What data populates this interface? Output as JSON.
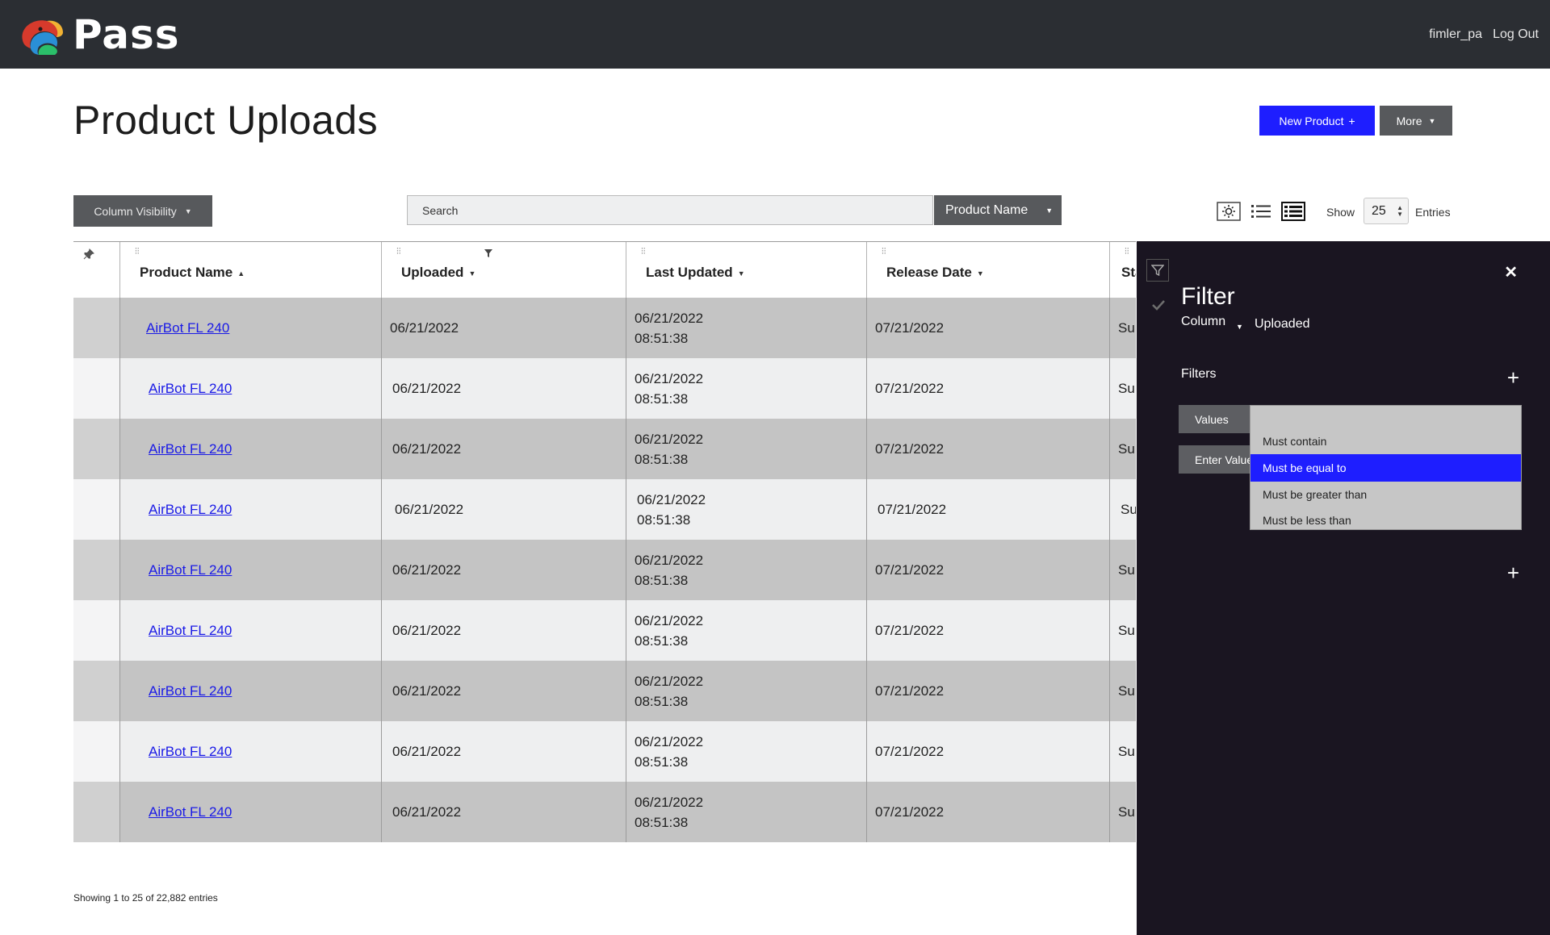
{
  "app": {
    "brand": "Pass",
    "username": "fimler_pa",
    "logout_label": "Log Out"
  },
  "header": {
    "title": "Product Uploads",
    "new_product_label": "New Product",
    "more_label": "More"
  },
  "toolbar": {
    "column_visibility_label": "Column Visibility",
    "search_value": "Search",
    "search_field_label": "Product Name",
    "show_label": "Show",
    "page_size": "25",
    "entries_label": "Entries"
  },
  "table": {
    "columns": [
      "Product Name",
      "Uploaded",
      "Last Updated",
      "Release Date",
      "Sta"
    ],
    "rows": [
      {
        "name": "AirBot FL 240",
        "uploaded": "06/21/2022",
        "updated_date": "06/21/2022",
        "updated_time": "08:51:38",
        "release": "07/21/2022",
        "status": "Su"
      },
      {
        "name": "AirBot FL 240",
        "uploaded": "06/21/2022",
        "updated_date": "06/21/2022",
        "updated_time": "08:51:38",
        "release": "07/21/2022",
        "status": "Su"
      },
      {
        "name": "AirBot FL 240",
        "uploaded": "06/21/2022",
        "updated_date": "06/21/2022",
        "updated_time": "08:51:38",
        "release": "07/21/2022",
        "status": "Su"
      },
      {
        "name": "AirBot FL 240",
        "uploaded": "06/21/2022",
        "updated_date": "06/21/2022",
        "updated_time": "08:51:38",
        "release": "07/21/2022",
        "status": "Su"
      },
      {
        "name": "AirBot FL 240",
        "uploaded": "06/21/2022",
        "updated_date": "06/21/2022",
        "updated_time": "08:51:38",
        "release": "07/21/2022",
        "status": "Su"
      },
      {
        "name": "AirBot FL 240",
        "uploaded": "06/21/2022",
        "updated_date": "06/21/2022",
        "updated_time": "08:51:38",
        "release": "07/21/2022",
        "status": "Su"
      },
      {
        "name": "AirBot FL 240",
        "uploaded": "06/21/2022",
        "updated_date": "06/21/2022",
        "updated_time": "08:51:38",
        "release": "07/21/2022",
        "status": "Su"
      },
      {
        "name": "AirBot FL 240",
        "uploaded": "06/21/2022",
        "updated_date": "06/21/2022",
        "updated_time": "08:51:38",
        "release": "07/21/2022",
        "status": "Su"
      },
      {
        "name": "AirBot FL 240",
        "uploaded": "06/21/2022",
        "updated_date": "06/21/2022",
        "updated_time": "08:51:38",
        "release": "07/21/2022",
        "status": "Su"
      }
    ]
  },
  "footer": {
    "info": "Showing 1 to 25 of 22,882 entries"
  },
  "filter_panel": {
    "title": "Filter",
    "column_label": "Column",
    "column_value": "Uploaded",
    "filters_label": "Filters",
    "values_label": "Values",
    "enter_value_label": "Enter Value",
    "options": [
      "Must contain",
      "Must be equal to",
      "Must be greater than",
      "Must be less than"
    ],
    "selected_option": "Must be equal to"
  },
  "colors": {
    "topbar": "#2b2e33",
    "primary": "#1e1eff",
    "panel_bg": "#1a1521",
    "link": "#1a1ae6"
  }
}
